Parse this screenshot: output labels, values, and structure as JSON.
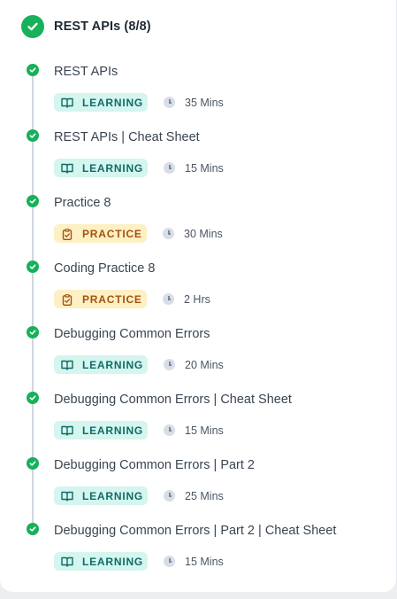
{
  "module": {
    "title": "REST APIs (8/8)",
    "status_color": "#16b15a"
  },
  "colors": {
    "learning_bg": "#d5f5ef",
    "learning_text": "#0f6b68",
    "practice_bg": "#fdf0c4",
    "practice_text": "#a5520f",
    "complete": "#16b15a"
  },
  "items": [
    {
      "title": "REST APIs",
      "type": "LEARNING",
      "icon": "book-icon",
      "duration": "35 Mins"
    },
    {
      "title": "REST APIs | Cheat Sheet",
      "type": "LEARNING",
      "icon": "book-icon",
      "duration": "15 Mins"
    },
    {
      "title": "Practice 8",
      "type": "PRACTICE",
      "icon": "clipboard-icon",
      "duration": "30 Mins"
    },
    {
      "title": "Coding Practice 8",
      "type": "PRACTICE",
      "icon": "clipboard-icon",
      "duration": "2 Hrs"
    },
    {
      "title": "Debugging Common Errors",
      "type": "LEARNING",
      "icon": "book-icon",
      "duration": "20 Mins"
    },
    {
      "title": "Debugging Common Errors | Cheat Sheet",
      "type": "LEARNING",
      "icon": "book-icon",
      "duration": "15 Mins"
    },
    {
      "title": "Debugging Common Errors | Part 2",
      "type": "LEARNING",
      "icon": "book-icon",
      "duration": "25 Mins"
    },
    {
      "title": "Debugging Common Errors | Part 2 | Cheat Sheet",
      "type": "LEARNING",
      "icon": "book-icon",
      "duration": "15 Mins"
    }
  ]
}
